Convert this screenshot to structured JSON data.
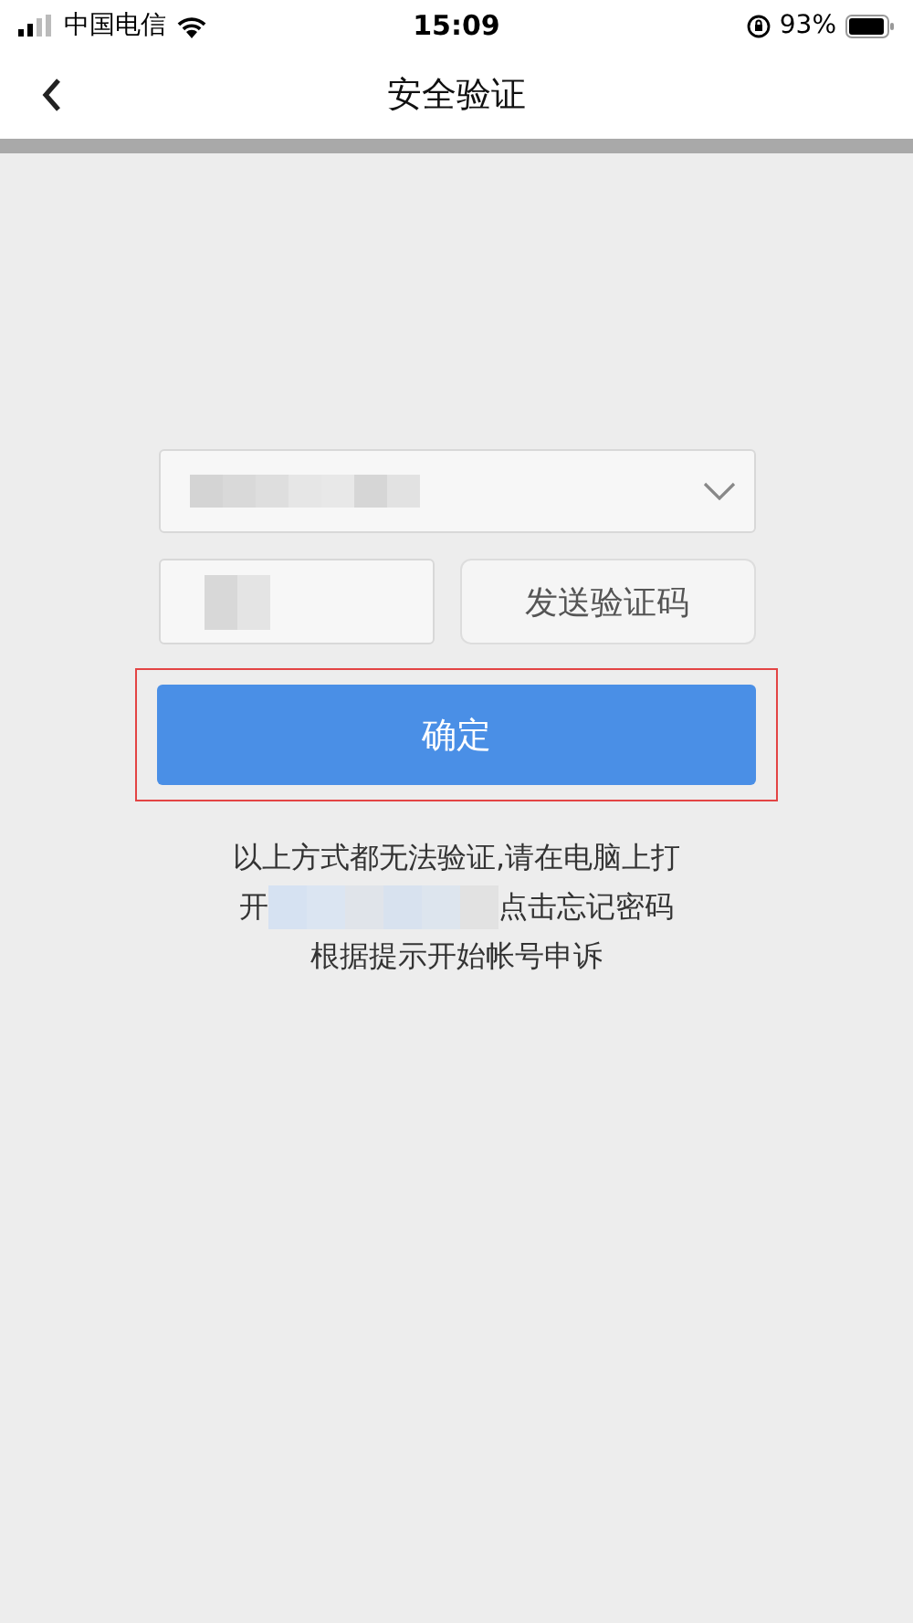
{
  "status_bar": {
    "carrier": "中国电信",
    "time": "15:09",
    "battery": "93%"
  },
  "header": {
    "title": "安全验证"
  },
  "form": {
    "send_code_button": "发送验证码",
    "confirm_button": "确定",
    "highlighted": true
  },
  "notice": {
    "line_1": "以上方式都无法验证,请在电脑上打",
    "line_2_start": "开",
    "line_2_end": "点击忘记密码",
    "line_3": "根据提示开始帐号申诉"
  }
}
